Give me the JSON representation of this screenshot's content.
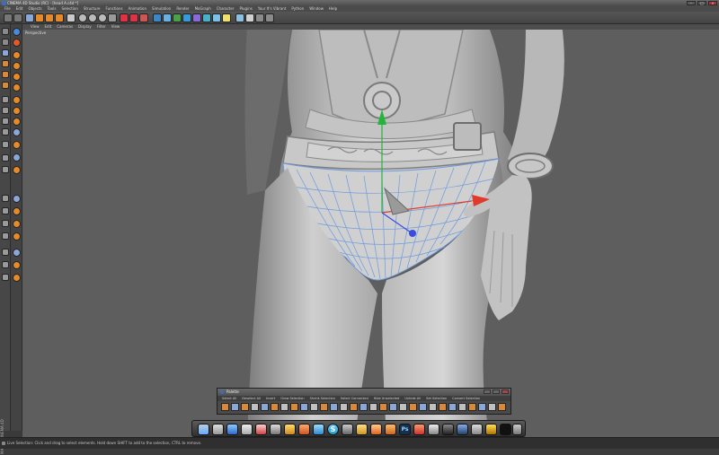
{
  "window": {
    "title": "CINEMA 4D Studio (RC) - [head A.c4d *]",
    "controls": [
      "–",
      "□",
      "×"
    ]
  },
  "menubar": {
    "items": [
      "File",
      "Edit",
      "Objects",
      "Tools",
      "Selection",
      "Structure",
      "Functions",
      "Animation",
      "Simulation",
      "Render",
      "MoGraph",
      "Character",
      "Plugins",
      "Your It's Vibrant",
      "Python",
      "Window",
      "Help"
    ]
  },
  "viewport": {
    "menu": [
      "View",
      "Edit",
      "Cameras",
      "Display",
      "Filter",
      "View"
    ],
    "label": "Perspective"
  },
  "side_panel": {
    "label": "MAXON CINEMA 4D"
  },
  "palette": {
    "title": "Palette",
    "menu": [
      "Select All",
      "Deselect All",
      "Invert",
      "Grow Selection",
      "Shrink Selection",
      "Select Connected",
      "Hide Unselected",
      "Unhide All",
      "Set Selection",
      "Convert Selection"
    ]
  },
  "status": {
    "text": "Live Selection: Click and drag to select elements. Hold down SHIFT to add to the selection, CTRL to remove."
  },
  "colors": {
    "ui_dark": "#3a3a3a",
    "viewport_bg": "#5e5e5e",
    "model": "#c8c8c8",
    "mesh_lines": "#6c9ae0",
    "axis_x": "#e03a2a",
    "axis_y": "#23b53a",
    "axis_z": "#3a4ce0",
    "accent_orange": "#e48a2a"
  },
  "icons": {
    "toolbar": [
      "undo-icon",
      "redo-icon",
      "move-icon",
      "scale-icon",
      "rotate-icon",
      "live-selection-icon",
      "x-axis-icon",
      "y-axis-icon",
      "z-axis-icon",
      "world-coordinate-icon",
      "render-icon",
      "render-view-icon",
      "render-settings-icon",
      "cube-icon",
      "pen-icon",
      "subdivision-icon",
      "array-icon",
      "scene-icon",
      "camera-icon",
      "light-icon"
    ],
    "dock": [
      "finder-icon",
      "mail-icon",
      "safari-icon",
      "itunes-icon",
      "chrome-icon",
      "firefox-icon",
      "app-store-icon",
      "skype-icon",
      "calculator-icon",
      "stocks-icon",
      "preview-icon",
      "photoshop-icon",
      "zbrush-icon",
      "unity-icon",
      "cinema4d-icon",
      "terminal-icon",
      "trash-icon"
    ]
  }
}
